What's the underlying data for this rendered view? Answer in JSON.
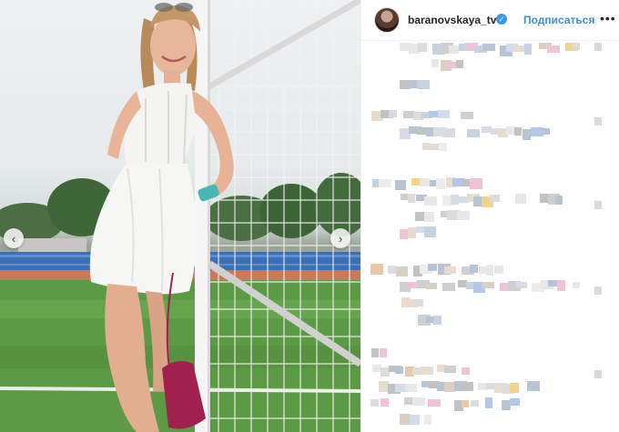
{
  "post": {
    "username": "baranovskaya_tv",
    "verified": true,
    "follow_label": "Подписаться",
    "more_label": "•••"
  },
  "carousel": {
    "prev_label": "‹",
    "next_label": "›"
  },
  "comments_pixelated": true,
  "colors": {
    "follow": "#3d8ed8",
    "verified_badge": "#3897f0",
    "grass": "#5c9a45",
    "dress": "#f4f4f2",
    "bag": "#a0214e"
  },
  "icons": [
    "verified-icon",
    "chevron-left-icon",
    "chevron-right-icon",
    "more-icon"
  ]
}
